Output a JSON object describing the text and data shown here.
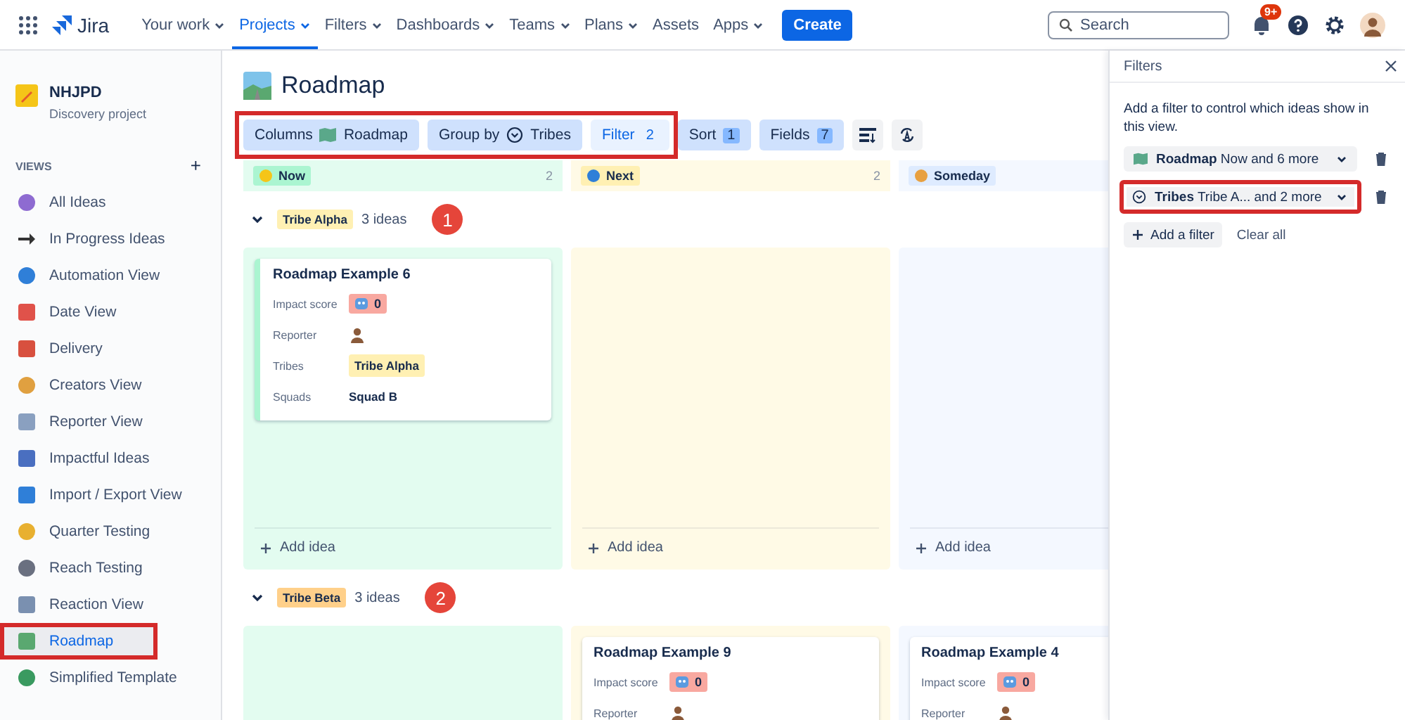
{
  "nav": {
    "product": "Jira",
    "items": [
      {
        "label": "Your work",
        "dropdown": true,
        "selected": false
      },
      {
        "label": "Projects",
        "dropdown": true,
        "selected": true
      },
      {
        "label": "Filters",
        "dropdown": true,
        "selected": false
      },
      {
        "label": "Dashboards",
        "dropdown": true,
        "selected": false
      },
      {
        "label": "Teams",
        "dropdown": true,
        "selected": false
      },
      {
        "label": "Plans",
        "dropdown": true,
        "selected": false
      },
      {
        "label": "Assets",
        "dropdown": false,
        "selected": false
      },
      {
        "label": "Apps",
        "dropdown": true,
        "selected": false
      }
    ],
    "create": "Create",
    "search": {
      "placeholder": "Search"
    },
    "notification_badge": "9+"
  },
  "sidebar": {
    "project": {
      "name": "NHJPD",
      "type": "Discovery project"
    },
    "section": "VIEWS",
    "add": "+",
    "items": [
      {
        "label": "All Ideas",
        "selected": false,
        "highlighted": false
      },
      {
        "label": "In Progress Ideas",
        "selected": false,
        "highlighted": false
      },
      {
        "label": "Automation View",
        "selected": false,
        "highlighted": false
      },
      {
        "label": "Date View",
        "selected": false,
        "highlighted": false
      },
      {
        "label": "Delivery",
        "selected": false,
        "highlighted": false
      },
      {
        "label": "Creators View",
        "selected": false,
        "highlighted": false
      },
      {
        "label": "Reporter View",
        "selected": false,
        "highlighted": false
      },
      {
        "label": "Impactful Ideas",
        "selected": false,
        "highlighted": false
      },
      {
        "label": "Import / Export View",
        "selected": false,
        "highlighted": false
      },
      {
        "label": "Quarter Testing",
        "selected": false,
        "highlighted": false
      },
      {
        "label": "Reach Testing",
        "selected": false,
        "highlighted": false
      },
      {
        "label": "Reaction View",
        "selected": false,
        "highlighted": false
      },
      {
        "label": "Roadmap",
        "selected": true,
        "highlighted": true
      },
      {
        "label": "Simplified Template",
        "selected": false,
        "highlighted": false
      }
    ]
  },
  "view": {
    "title": "Roadmap",
    "toolbar": [
      {
        "highlighted": true,
        "items": [
          {
            "kind": "value",
            "label": "Columns",
            "value": "Roadmap",
            "selected": false
          },
          {
            "kind": "value",
            "label": "Group by",
            "value": "Tribes",
            "selected": false
          },
          {
            "kind": "count",
            "label": "Filter",
            "count": "2",
            "selected": true
          }
        ]
      },
      {
        "highlighted": false,
        "items": [
          {
            "kind": "count",
            "label": "Sort",
            "count": "1",
            "selected": false
          },
          {
            "kind": "count",
            "label": "Fields",
            "count": "7",
            "selected": false
          }
        ]
      }
    ],
    "columns": [
      {
        "label": "Now",
        "count": "2",
        "color": "#abf5d1"
      },
      {
        "label": "Next",
        "count": "2",
        "color": "#fff0b3"
      },
      {
        "label": "Someday",
        "color": "#deebff"
      }
    ],
    "groups": [
      {
        "tribe": "Tribe Alpha",
        "color": "#fff0b3",
        "count": "3 ideas",
        "expanded": true,
        "marker": "1",
        "lanes": [
          {
            "kind": "cards",
            "add_label": "Add idea",
            "cards": [
              {
                "title": "Roadmap Example 6",
                "selected": true,
                "fields": [
                  {
                    "kind": "score",
                    "label": "Impact score",
                    "value": "0"
                  },
                  {
                    "kind": "avatar",
                    "label": "Reporter"
                  },
                  {
                    "kind": "tag",
                    "label": "Tribes",
                    "value": "Tribe Alpha",
                    "color": "#fff0b3"
                  },
                  {
                    "kind": "text",
                    "label": "Squads",
                    "value": "Squad B"
                  }
                ]
              }
            ]
          },
          {
            "kind": "empty",
            "add_label": "Add idea"
          },
          {
            "kind": "empty",
            "add_label": "Add idea"
          }
        ]
      },
      {
        "tribe": "Tribe Beta",
        "color": "#ffd08a",
        "count": "3 ideas",
        "expanded": true,
        "marker": "2",
        "lanes": [
          {
            "kind": "empty"
          },
          {
            "kind": "cards",
            "cards": [
              {
                "title": "Roadmap Example 9",
                "selected": false,
                "fields": [
                  {
                    "kind": "score",
                    "label": "Impact score",
                    "value": "0"
                  },
                  {
                    "kind": "avatar",
                    "label": "Reporter"
                  }
                ]
              }
            ]
          },
          {
            "kind": "cards",
            "cards": [
              {
                "title": "Roadmap Example 4",
                "selected": false,
                "fields": [
                  {
                    "kind": "score",
                    "label": "Impact score",
                    "value": "0"
                  },
                  {
                    "kind": "avatar",
                    "label": "Reporter"
                  }
                ]
              }
            ]
          }
        ]
      }
    ]
  },
  "filters": {
    "title": "Filters",
    "description": "Add a filter to control which ideas show in this view.",
    "items": [
      {
        "field": "Roadmap",
        "value": "Now and 6 more",
        "highlighted": false
      },
      {
        "field": "Tribes",
        "value": "Tribe A... and 2 more",
        "highlighted": true
      }
    ],
    "add": "Add a filter",
    "clear": "Clear all"
  }
}
